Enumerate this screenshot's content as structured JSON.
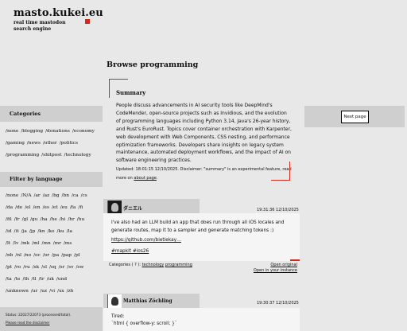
{
  "header": {
    "title": "masto.kukei.eu",
    "subtitle_line1": "real time mastodon",
    "subtitle_line2": "search engine"
  },
  "sidebar": {
    "categories_heading": "Categories",
    "categories": [
      [
        "/none",
        "/blogging",
        "/donations",
        "/economy"
      ],
      [
        "/gaming",
        "/news",
        "/other",
        "/politics"
      ],
      [
        "/programming",
        "/shitpost",
        "/technology"
      ]
    ],
    "language_heading": "Filter by language",
    "languages": [
      [
        "/none",
        "/N/A",
        "/ar",
        "/az",
        "/bg",
        "/bn",
        "/ca",
        "/cs"
      ],
      [
        "/da",
        "/de",
        "/el",
        "/en",
        "/es",
        "/et",
        "/eu",
        "/fa",
        "/fi"
      ],
      [
        "/fil",
        "/fr",
        "/gl",
        "/gu",
        "/ha",
        "/he",
        "/hi",
        "/hr",
        "/hu"
      ],
      [
        "/id",
        "/it",
        "/ja",
        "/jp",
        "/kn",
        "/ko",
        "/ku",
        "/la"
      ],
      [
        "/lt",
        "/lv",
        "/mk",
        "/ml",
        "/mn",
        "/mr",
        "/ms"
      ],
      [
        "/nb",
        "/nl",
        "/no",
        "/oc",
        "/or",
        "/pa",
        "/pap",
        "/pl"
      ],
      [
        "/pt",
        "/ro",
        "/ru",
        "/sk",
        "/sl",
        "/sq",
        "/sr",
        "/sv",
        "/sw"
      ],
      [
        "/ta",
        "/te",
        "/th",
        "/tl",
        "/tr",
        "/uk",
        "/und"
      ],
      [
        "/unknown",
        "/ur",
        "/uz",
        "/vi",
        "/xx",
        "/zh"
      ]
    ]
  },
  "main": {
    "title": "Browse programming",
    "summary_title": "Summary",
    "summary_text": "People discuss advancements in AI security tools like DeepMind's CodeMender, open-source projects such as Invidious, and the evolution of programming languages including Python 3.14, Java's 26-year history, and Rust's EuroRust. Topics cover container orchestration with Karpenter, web development with Web Components, CSS nesting, and performance optimization frameworks. Developers share insights on legacy system maintenance, automated deployment workflows, and the impact of AI on software engineering practices.",
    "summary_meta": "Updated: 18:01:15 12/10/2025. Disclaimer: \"summary\" is an experimental feature, read more on",
    "about_link": "about page",
    "about_suffix": "."
  },
  "pager": {
    "next_label": "Next page"
  },
  "posts": [
    {
      "author": "ダニエル",
      "timestamp": "19:31:36 12/10/2025",
      "content": "I've also had an LLM build an app that does run through all iOS locales and generate routes, map it to a sampler and generate matching tokens :)",
      "url": "https://github.com/bietiekay…",
      "hashtags": "#mapkit #ios26",
      "categories_prefix": "Categories ( ? ):",
      "categories": [
        "technology",
        "programming"
      ],
      "open_original": "Open original",
      "open_instance": "Open in your instance"
    },
    {
      "author": "Matthias Zöchling",
      "timestamp": "19:30:37 12/10/2025",
      "content_line1": "Tired:",
      "content_line2": "`html { overflow-y: scroll; }`"
    }
  ],
  "status": {
    "text": "Status: 22027/22073 (processed/total).",
    "disclaimer": "Please read the disclaimer"
  },
  "colors": {
    "accent": "#d42a1c",
    "panel": "#cfcfcf",
    "background": "#e8e8e8"
  }
}
